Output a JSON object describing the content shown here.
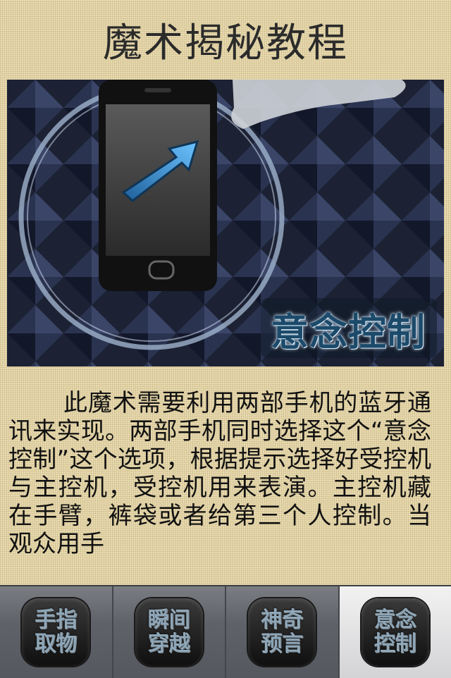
{
  "header": {
    "title": "魔术揭秘教程"
  },
  "hero": {
    "caption": "意念控制",
    "description": "phone with blue arrow and pointing hand"
  },
  "article": {
    "text": "此魔术需要利用两部手机的蓝牙通讯来实现。两部手机同时选择这个“意念控制”这个选项，根据提示选择好受控机与主控机，受控机用来表演。主控机藏在手臂，裤袋或者给第三个人控制。当观众用手"
  },
  "tabs": [
    {
      "line1": "手指",
      "line2": "取物",
      "active": false
    },
    {
      "line1": "瞬间",
      "line2": "穿越",
      "active": false
    },
    {
      "line1": "神奇",
      "line2": "预言",
      "active": false
    },
    {
      "line1": "意念",
      "line2": "控制",
      "active": true
    }
  ],
  "colors": {
    "background": "#e9dcb2",
    "tab_active": "#e6e6e8",
    "tab_inactive": "#63666c",
    "caption": "#1c4a6a"
  }
}
